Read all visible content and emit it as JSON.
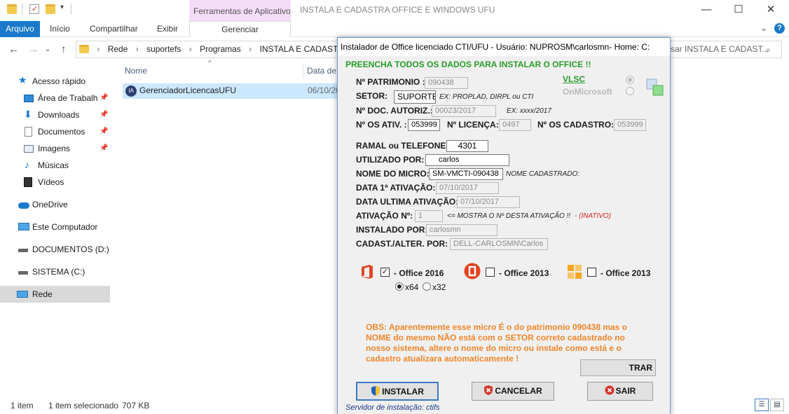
{
  "explorer": {
    "contextual_tab_title": "Ferramentas de Aplicativo",
    "window_title": "INSTALA E CADASTRA OFFICE E WINDOWS UFU",
    "ribbon_tabs": [
      "Arquivo",
      "Início",
      "Compartilhar",
      "Exibir"
    ],
    "contextual_tab": "Gerenciar",
    "breadcrumbs": [
      "Rede",
      "suportefs",
      "Programas",
      "INSTALA E CADASTRA OF"
    ],
    "search_placeholder": "sar INSTALA E CADAST...",
    "nav_items": [
      {
        "label": "Acesso rápido",
        "icon": "star-icon"
      },
      {
        "label": "Área de Trabalho",
        "icon": "desktop-icon"
      },
      {
        "label": "Downloads",
        "icon": "download-icon"
      },
      {
        "label": "Documentos",
        "icon": "document-icon"
      },
      {
        "label": "Imagens",
        "icon": "image-icon"
      },
      {
        "label": "Músicas",
        "icon": "music-icon"
      },
      {
        "label": "Vídeos",
        "icon": "video-icon"
      },
      {
        "label": "OneDrive",
        "icon": "cloud-icon"
      },
      {
        "label": "Este Computador",
        "icon": "computer-icon"
      },
      {
        "label": "DOCUMENTOS (D:)",
        "icon": "drive-icon"
      },
      {
        "label": "SISTEMA (C:)",
        "icon": "drive-icon"
      },
      {
        "label": "Rede",
        "icon": "network-icon"
      }
    ],
    "columns": {
      "name": "Nome",
      "date": "Data de"
    },
    "file": {
      "name": "GerenciadorLicencasUFU",
      "date": "06/10/20"
    },
    "status": {
      "count": "1 item",
      "selected": "1 item selecionado",
      "size": "707 KB"
    }
  },
  "dialog": {
    "title": "Instalador de Office licenciado CTI/UFU - Usuário: NUPROSM\\carlosmn- Home: C:",
    "heading": "PREENCHA TODOS OS DADOS PARA INSTALAR O OFFICE !!",
    "vlsc": "VLSC",
    "onmicrosoft": "OnMicrosoft",
    "labels": {
      "patrimonio": "Nº PATRIMONIO :",
      "setor": "SETOR:",
      "doc": "Nº DOC. AUTORIZ.:",
      "os_ativ": "Nº OS ATIV. :",
      "licenca": "Nº LICENÇA:",
      "os_cadastro": "Nº OS CADASTRO:",
      "ramal": "RAMAL ou TELEFONE:",
      "utilizado": "UTILIZADO POR:",
      "micro": "NOME DO MICRO:",
      "data1": "DATA 1ª ATIVAÇÃO:",
      "data_ultima": "DATA ULTIMA ATIVAÇÃO:",
      "ativacao": "ATIVAÇÃO Nº:",
      "instalado": "INSTALADO POR:",
      "cadast": "CADAST./ALTER. POR:"
    },
    "values": {
      "patrimonio": "090438",
      "setor": "SUPORTE",
      "doc": "00023/2017",
      "os_ativ": "053999",
      "licenca": "0497",
      "os_cadastro": "053999",
      "ramal": "4301",
      "utilizado": "carlos",
      "micro": "SM-VMCTI-090438",
      "data1": "07/10/2017",
      "data_ultima": "07/10/2017",
      "ativacao": "1",
      "instalado": "carlosmn",
      "cadast": "DELL-CARLOSMN\\Carlos"
    },
    "hints": {
      "setor": "EX:  PROPLAD, DIRPL ou CTI",
      "doc": "EX:   xxxx/2017",
      "micro": "NOME CADASTRADO:",
      "ativacao": "<= MOSTRA O Nº DESTA ATIVAÇÃO !!",
      "inativo": " - (INATIVO)"
    },
    "office_options": [
      {
        "label": "- Office 2016",
        "checked": true,
        "icon": "office-2016-icon"
      },
      {
        "label": "- Office 2013",
        "checked": false,
        "icon": "office-2013-icon"
      },
      {
        "label": "- Office 2013",
        "checked": false,
        "icon": "office-2013-alt-icon"
      }
    ],
    "arch": {
      "x64": "x64",
      "x32": "x32",
      "selected": "x64"
    },
    "obs": "OBS: Aparentemente esse micro É o do patrimonio 090438 mas o NOME do mesmo NÃO está com o SETOR correto cadastrado no nosso sistema, altere o nome do micro ou instale como está e o cadastro atualizara automaticamente !",
    "mostrar_partial": "TRAR",
    "buttons": {
      "instalar": "INSTALAR",
      "cancelar": "CANCELAR",
      "sair": "SAIR"
    },
    "server": "Servidor de instalação: ctifs",
    "colors": {
      "heading": "#2a9d2a",
      "obs": "#f0862b",
      "inativo": "#cc2222",
      "server": "#1a3a8a"
    }
  }
}
